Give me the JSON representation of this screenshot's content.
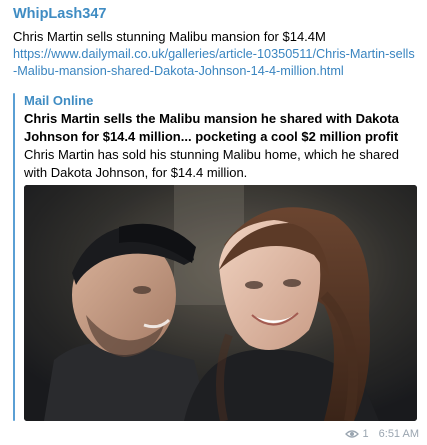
{
  "message": {
    "sender": "WhipLash347",
    "text": "Chris Martin sells stunning Malibu mansion for $14.4M",
    "link": "https://www.dailymail.co.uk/galleries/article-10350511/Chris-Martin-sells-Malibu-mansion-shared-Dakota-Johnson-14-4-million.html"
  },
  "preview": {
    "site_name": "Mail Online",
    "title": "Chris Martin sells the Malibu mansion he shared with Dakota Johnson for $14.4 million... pocketing a cool $2 million profit o...",
    "description": "Chris Martin has sold his stunning Malibu home, which he shared with Dakota Johnson, for $14.4 million.",
    "image_icon": "photo-of-two-people"
  },
  "meta": {
    "views": "1",
    "time": "6:51 AM",
    "views_icon": "eye-icon"
  },
  "colors": {
    "accent": "#3f8cc3",
    "link": "#3a85c0",
    "meta": "#9aa5b0"
  }
}
